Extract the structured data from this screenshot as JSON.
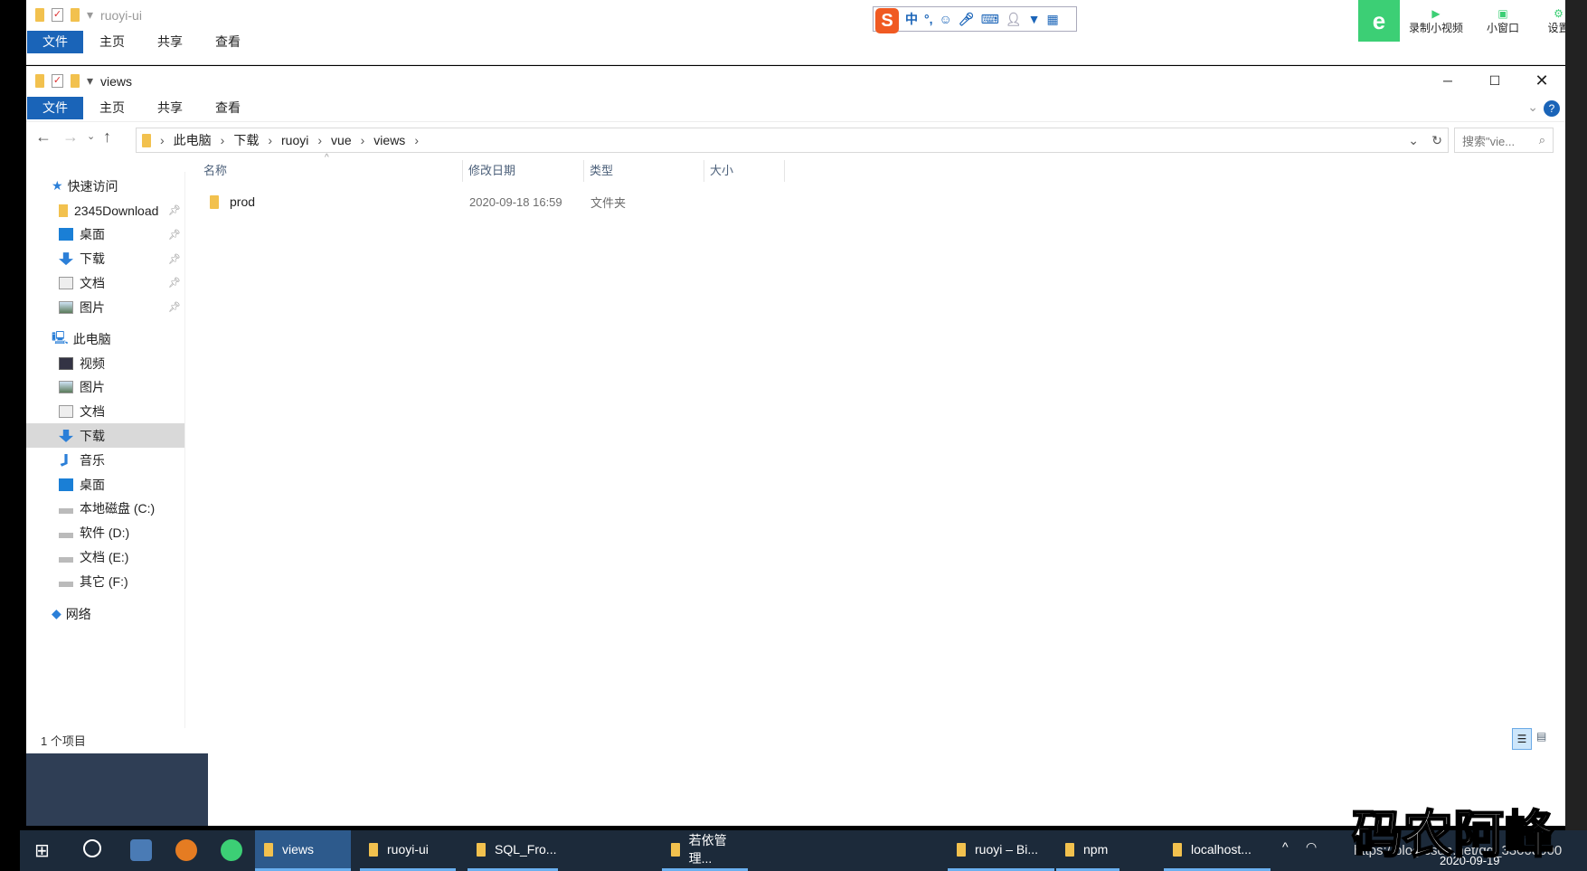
{
  "back_window": {
    "title": "ruoyi-ui",
    "tabs": [
      "文件",
      "主页",
      "共享",
      "查看"
    ]
  },
  "ime": {
    "logo": "S",
    "items": [
      "中",
      "°,"
    ]
  },
  "recorder": {
    "logo": "e",
    "buttons": [
      "录制小视频",
      "小窗口",
      "设置"
    ]
  },
  "window": {
    "title": "views",
    "tabs": [
      "文件",
      "主页",
      "共享",
      "查看"
    ],
    "breadcrumb": [
      "此电脑",
      "下载",
      "ruoyi",
      "vue",
      "views"
    ],
    "search_placeholder": "搜索\"vie...",
    "columns": [
      "名称",
      "修改日期",
      "类型",
      "大小"
    ],
    "files": [
      {
        "name": "prod",
        "modified": "2020-09-18 16:59",
        "type": "文件夹",
        "size": ""
      }
    ],
    "status": "1 个项目"
  },
  "sidebar": {
    "quick_access": "快速访问",
    "quick_items": [
      {
        "label": "2345Download",
        "icon": "folder-icon"
      },
      {
        "label": "桌面",
        "icon": "desktop-icon"
      },
      {
        "label": "下载",
        "icon": "download-icon"
      },
      {
        "label": "文档",
        "icon": "document-icon"
      },
      {
        "label": "图片",
        "icon": "picture-icon"
      }
    ],
    "this_pc": "此电脑",
    "pc_items": [
      {
        "label": "视频",
        "icon": "video-icon"
      },
      {
        "label": "图片",
        "icon": "picture-icon"
      },
      {
        "label": "文档",
        "icon": "document-icon"
      },
      {
        "label": "下载",
        "icon": "download-icon",
        "selected": true
      },
      {
        "label": "音乐",
        "icon": "music-icon"
      },
      {
        "label": "桌面",
        "icon": "desktop-icon"
      },
      {
        "label": "本地磁盘 (C:)",
        "icon": "drive-icon"
      },
      {
        "label": "软件 (D:)",
        "icon": "drive-icon"
      },
      {
        "label": "文档 (E:)",
        "icon": "drive-icon"
      },
      {
        "label": "其它 (F:)",
        "icon": "drive-icon"
      }
    ],
    "network": "网络"
  },
  "taskbar": {
    "items": [
      {
        "label": "views",
        "active": true
      },
      {
        "label": "ruoyi-ui"
      },
      {
        "label": "SQL_Fro..."
      },
      {
        "label": "若依管理..."
      },
      {
        "label": "ruoyi – Bi..."
      },
      {
        "label": "npm"
      },
      {
        "label": "localhost..."
      }
    ],
    "clock_date": "2020-09-19"
  },
  "watermark": {
    "url": "https://blog.csdn.net/qq_33608000",
    "text": "码农阿峰"
  },
  "colors": {
    "accent": "#1a64b8",
    "taskbar": "#1c2a3a",
    "green": "#3ccf75"
  }
}
